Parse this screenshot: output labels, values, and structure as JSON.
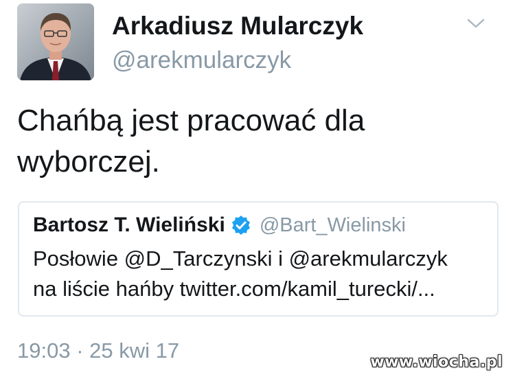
{
  "author": {
    "display_name": "Arkadiusz Mularczyk",
    "handle": "@arekmularczyk",
    "avatar_icon": "profile-photo"
  },
  "menu_icon": "chevron-down-icon",
  "tweet": {
    "text_line1": "Chańbą jest pracować dla",
    "text_line2": "wyborczej."
  },
  "quoted_tweet": {
    "display_name": "Bartosz T. Wieliński",
    "verified": true,
    "verified_color": "#1da1f2",
    "handle": "@Bart_Wielinski",
    "line1": "Posłowie @D_Tarczynski i @arekmularczyk",
    "line2": "na liście hańby twitter.com/kamil_turecki/..."
  },
  "timestamp": "19:03 · 25 kwi 17",
  "watermark": "www.wiocha.pl",
  "colors": {
    "text": "#14171a",
    "secondary": "#8899a6",
    "border": "#e1e8ed"
  }
}
